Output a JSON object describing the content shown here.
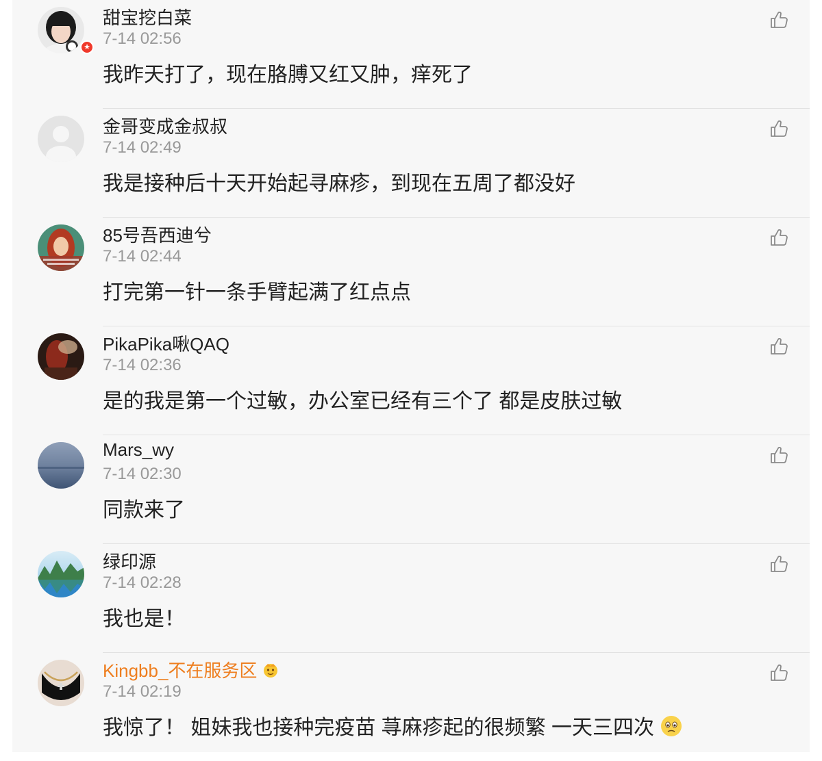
{
  "comments": [
    {
      "username": "甜宝挖白菜",
      "time": "7-14 02:56",
      "text": "我昨天打了，现在胳膊又红又肿，痒死了",
      "avatar": "avatar-girl",
      "verified": true
    },
    {
      "username": "金哥变成金叔叔",
      "time": "7-14 02:49",
      "text": "我是接种后十天开始起寻麻疹，到现在五周了都没好",
      "avatar": "avatar-default"
    },
    {
      "username": "85号吾西迪兮",
      "time": "7-14 02:44",
      "text": "打完第一针一条手臂起满了红点点",
      "avatar": "avatar-anime"
    },
    {
      "username": "PikaPika啾QAQ",
      "time": "7-14 02:36",
      "text": "是的我是第一个过敏，办公室已经有三个了 都是皮肤过敏",
      "avatar": "avatar-dark"
    },
    {
      "username": "Mars_wy",
      "time": "7-14 02:30",
      "text": "同款来了",
      "avatar": "avatar-sea"
    },
    {
      "username": "绿印源",
      "time": "7-14 02:28",
      "text": "我也是！",
      "avatar": "avatar-landscape"
    },
    {
      "username": "Kingbb_不在服务区",
      "time": "7-14 02:19",
      "text": "我惊了！ 姐妹我也接种完疫苗 荨麻疹起的很频繁 一天三四次",
      "avatar": "avatar-necklace",
      "username_color": "#ee7e1f",
      "username_emoji": "crown-emoji",
      "text_emoji": "worried-emoji"
    }
  ],
  "icons": {
    "like": "thumbs-up-icon"
  },
  "colors": {
    "vip_name": "#ee7e1f",
    "time": "#999999",
    "text": "#222222",
    "background": "#f7f7f7"
  }
}
